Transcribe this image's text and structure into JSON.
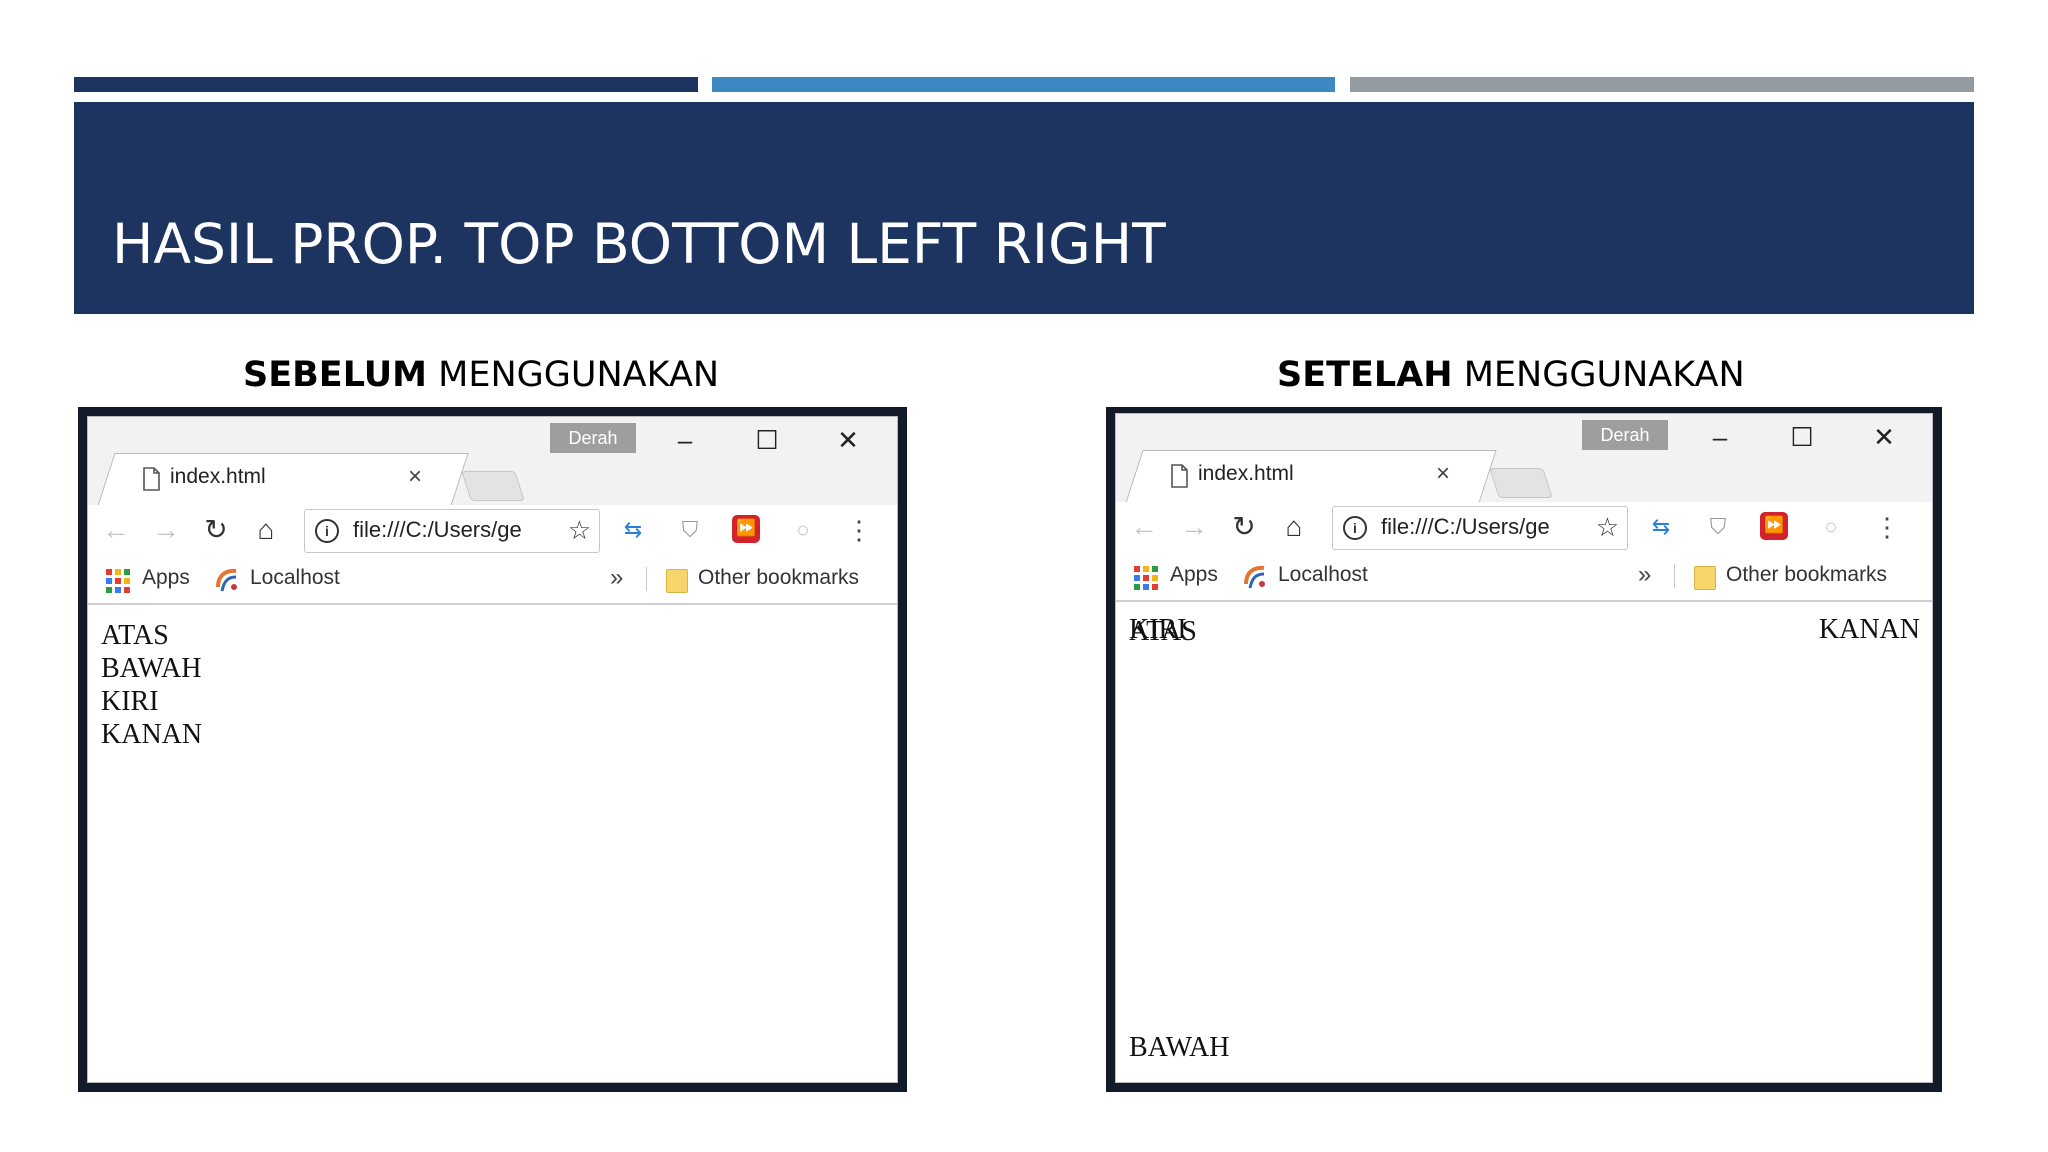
{
  "header": {
    "title": "HASIL PROP. TOP BOTTOM LEFT RIGHT"
  },
  "captions": {
    "left_bold": "SEBELUM",
    "left_rest": " MENGGUNAKAN",
    "right_bold": "SETELAH",
    "right_rest": " MENGGUNAKAN"
  },
  "browser": {
    "profile_label": "Derah",
    "tab_title": "index.html",
    "tab_close": "×",
    "minimize": "–",
    "maximize": "☐",
    "close": "✕",
    "back": "←",
    "forward": "→",
    "reload": "↻",
    "home": "⌂",
    "address": "file:///C:/Users/ge",
    "star": "☆",
    "info": "i",
    "ext_sync": "⇆",
    "ext_shield": "⛉",
    "ext_red": "⏩",
    "ext_circle": "○",
    "menu": "⋮",
    "bookmarks": {
      "apps": "Apps",
      "localhost": "Localhost",
      "more": "»",
      "other": "Other bookmarks"
    }
  },
  "before": {
    "lines": [
      "ATAS",
      "BAWAH",
      "KIRI",
      "KANAN"
    ]
  },
  "after": {
    "top": "ATAS",
    "left": "KIRI",
    "right": "KANAN",
    "bottom": "BAWAH"
  }
}
